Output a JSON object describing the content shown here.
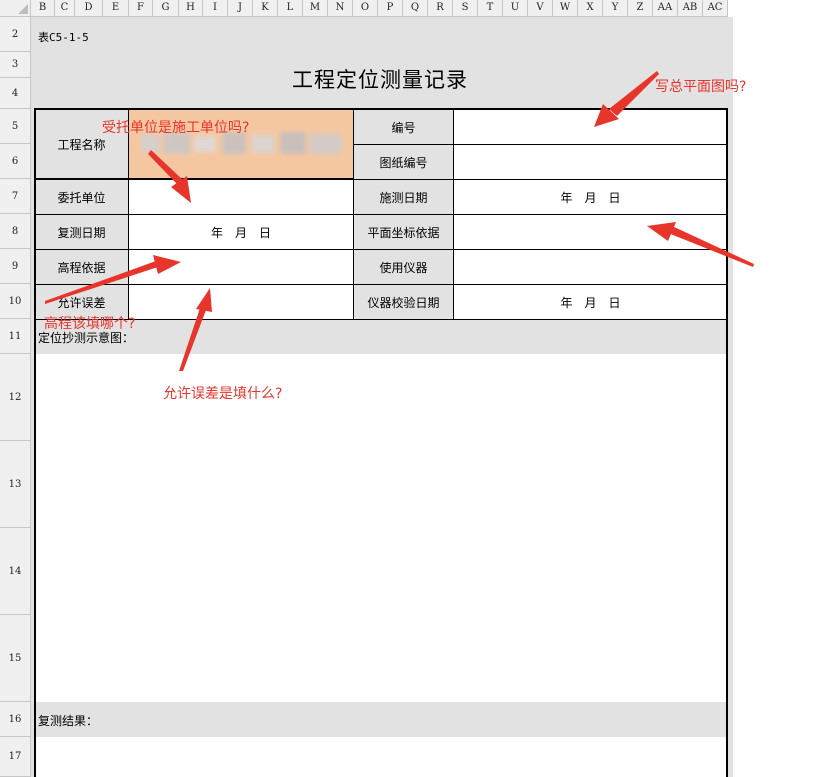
{
  "spreadsheet": {
    "column_headers": [
      "B",
      "C",
      "D",
      "E",
      "F",
      "G",
      "H",
      "I",
      "J",
      "K",
      "L",
      "M",
      "N",
      "O",
      "P",
      "Q",
      "R",
      "S",
      "T",
      "U",
      "V",
      "W",
      "X",
      "Y",
      "Z",
      "AA",
      "AB",
      "AC"
    ],
    "row_headers": [
      "2",
      "3",
      "4",
      "5",
      "6",
      "7",
      "8",
      "9",
      "10",
      "11",
      "12",
      "13",
      "14",
      "15",
      "16",
      "17"
    ]
  },
  "form": {
    "code": "表C5-1-5",
    "title": "工程定位测量记录",
    "project_name_label": "工程名称",
    "number_label": "编号",
    "drawing_number_label": "图纸编号",
    "client_label": "委托单位",
    "survey_date_label": "施测日期",
    "survey_date_value": "年　月　日",
    "recheck_date_label": "复测日期",
    "recheck_date_value": "年　月　日",
    "plane_coord_label": "平面坐标依据",
    "elevation_basis_label": "高程依据",
    "instrument_label": "使用仪器",
    "tolerance_label": "允许误差",
    "calibration_date_label": "仪器校验日期",
    "calibration_date_value": "年　月　日",
    "sketch_label": "定位抄测示意图：",
    "result_label": "复测结果："
  },
  "annotations": {
    "client_question": "受托单位是施工单位吗?",
    "plan_question": "写总平面图吗?",
    "elevation_question": "高程该填哪个?",
    "tolerance_question": "允许误差是填什么?"
  },
  "colors": {
    "annotation": "#e8352c",
    "project_name_highlight": "#f4c7a1",
    "label_fill": "#e2e2e2"
  }
}
